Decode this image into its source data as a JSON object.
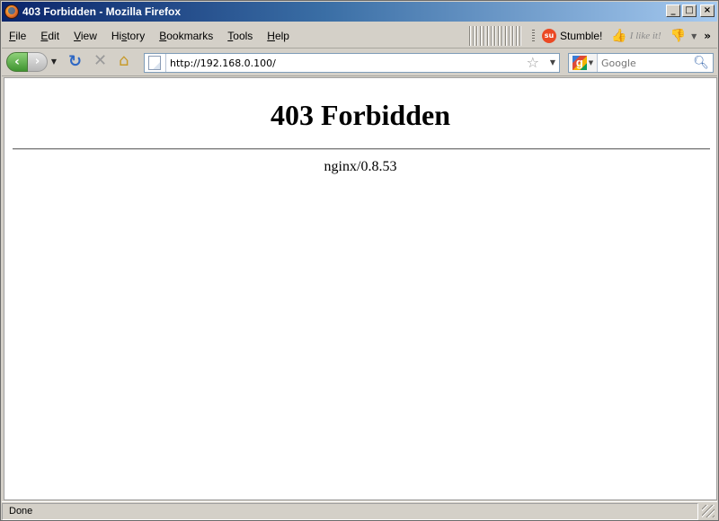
{
  "window": {
    "title": "403 Forbidden - Mozilla Firefox",
    "controls": {
      "minimize": "_",
      "maximize": "□",
      "close": "×"
    }
  },
  "menubar": {
    "items": [
      {
        "label": "File",
        "accel": "F"
      },
      {
        "label": "Edit",
        "accel": "E"
      },
      {
        "label": "View",
        "accel": "V"
      },
      {
        "label": "History",
        "accel": "s"
      },
      {
        "label": "Bookmarks",
        "accel": "B"
      },
      {
        "label": "Tools",
        "accel": "T"
      },
      {
        "label": "Help",
        "accel": "H"
      }
    ],
    "stumble_label": "Stumble!",
    "su_icon_text": "su",
    "like_label": "I like it!",
    "more": "»"
  },
  "navbar": {
    "url": "http://192.168.0.100/",
    "search_placeholder": "Google"
  },
  "page": {
    "heading": "403 Forbidden",
    "server_signature": "nginx/0.8.53"
  },
  "status": {
    "text": "Done"
  },
  "icons": {
    "back": "back-arrow-icon",
    "forward": "forward-arrow-icon",
    "reload": "reload-icon",
    "stop": "stop-icon",
    "home": "home-icon",
    "bookmark_star": "star-icon",
    "search": "magnifier-icon"
  },
  "colors": {
    "titlebar_start": "#0a246a",
    "titlebar_end": "#a6caf0",
    "chrome": "#d4d0c8",
    "back_button": "#3f9430",
    "reload": "#2f68c4",
    "stumble": "#eb4924"
  }
}
